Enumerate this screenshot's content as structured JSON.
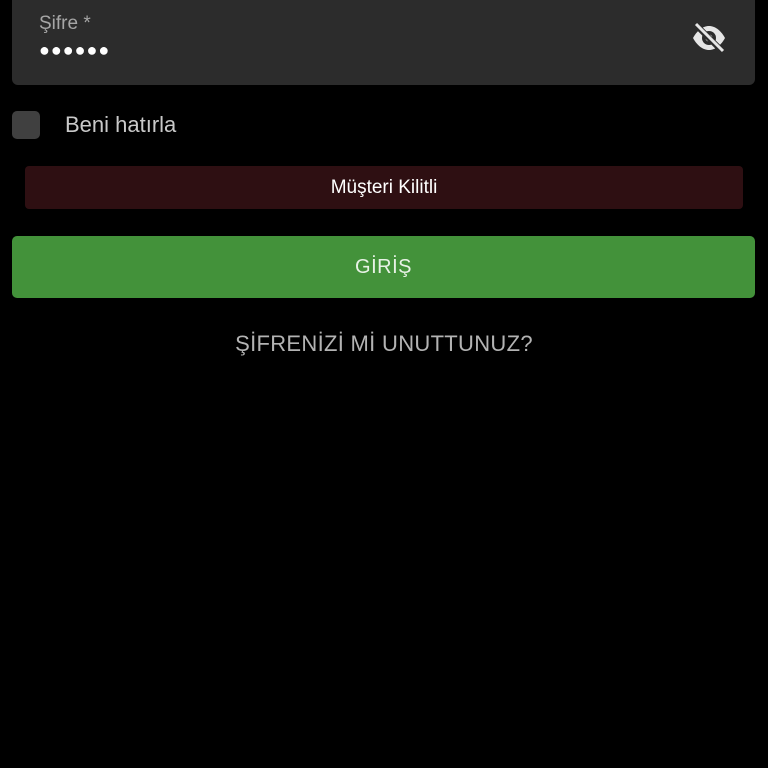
{
  "password_field": {
    "label": "Şifre *",
    "value": "●●●●●●",
    "toggle_icon": "eye-off-icon"
  },
  "remember": {
    "label": "Beni hatırla",
    "checked": false
  },
  "locked_banner": {
    "text": "Müşteri Kilitli"
  },
  "login_button": {
    "label": "GİRİŞ"
  },
  "forgot_link": {
    "label": "ŞİFRENİZİ Mİ UNUTTUNUZ?"
  },
  "colors": {
    "background": "#000000",
    "field_bg": "#2c2c2c",
    "banner_bg": "#2e0f12",
    "login_bg": "#43923a"
  }
}
